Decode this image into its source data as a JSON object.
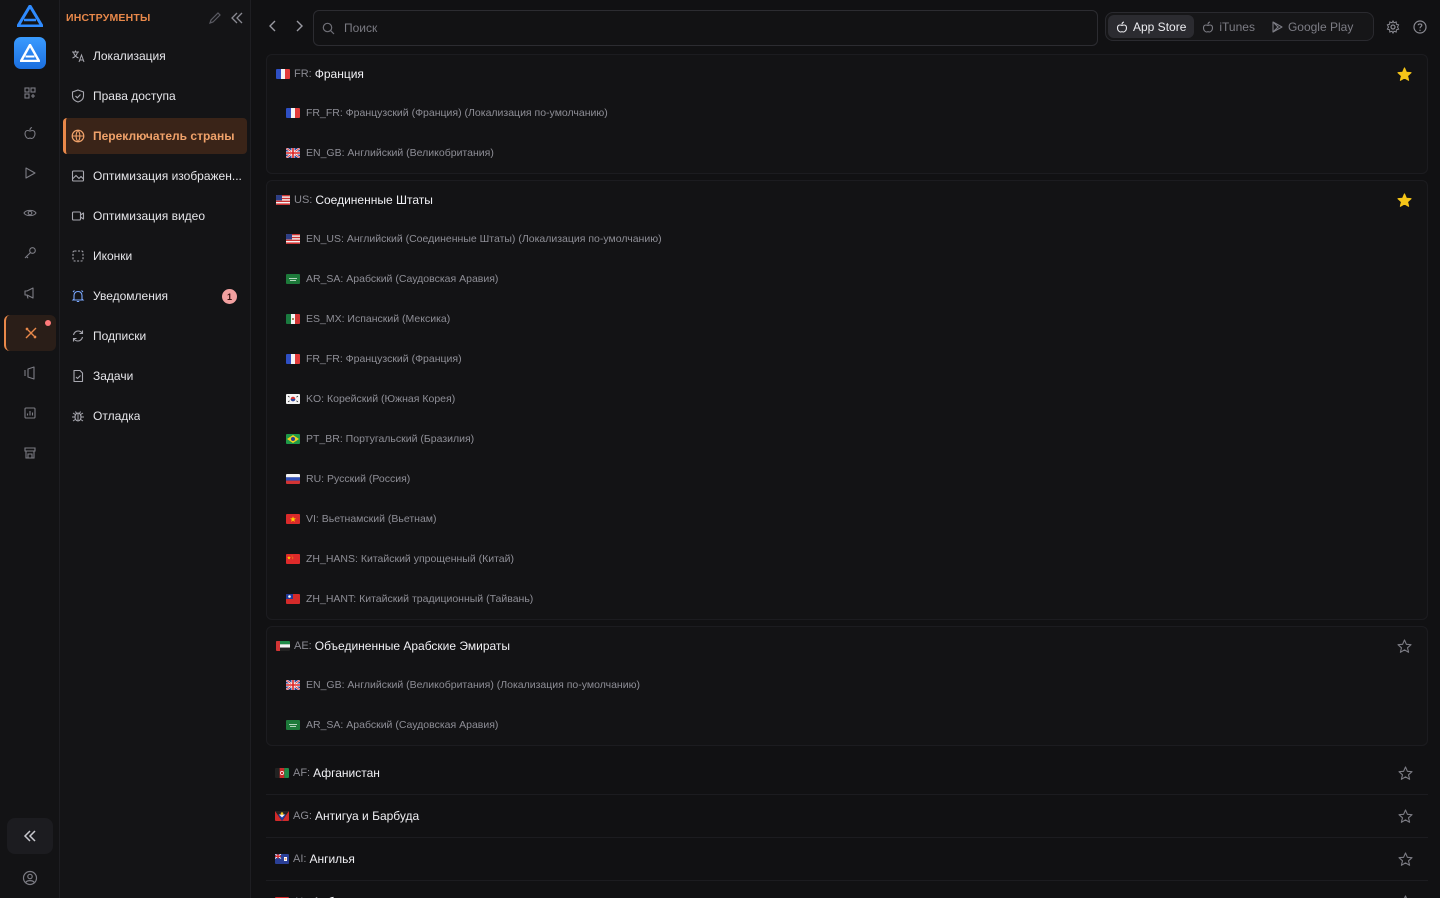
{
  "rail": {
    "items": [
      {
        "icon": "apps-icon"
      },
      {
        "icon": "apple-icon"
      },
      {
        "icon": "play-icon"
      },
      {
        "icon": "eye-icon"
      },
      {
        "icon": "key-icon"
      },
      {
        "icon": "megaphone-icon"
      },
      {
        "icon": "tools-icon",
        "active": true
      },
      {
        "icon": "feedback-icon"
      },
      {
        "icon": "report-icon"
      },
      {
        "icon": "store-icon"
      }
    ]
  },
  "tools": {
    "title": "ИНСТРУМЕНТЫ",
    "items": [
      {
        "label": "Локализация",
        "icon": "translate-icon"
      },
      {
        "label": "Права доступа",
        "icon": "shield-icon"
      },
      {
        "label": "Переключатель страны",
        "icon": "globe-icon",
        "active": true
      },
      {
        "label": "Оптимизация изображен...",
        "icon": "image-icon"
      },
      {
        "label": "Оптимизация видео",
        "icon": "video-icon"
      },
      {
        "label": "Иконки",
        "icon": "icons-icon"
      },
      {
        "label": "Уведомления",
        "icon": "bell-icon",
        "badge": "1"
      },
      {
        "label": "Подписки",
        "icon": "refresh-icon"
      },
      {
        "label": "Задачи",
        "icon": "tasks-icon"
      },
      {
        "label": "Отладка",
        "icon": "bug-icon"
      }
    ]
  },
  "search": {
    "placeholder": "Поиск"
  },
  "stores": {
    "app_store": "App Store",
    "itunes": "iTunes",
    "google_play": "Google Play"
  },
  "colors": {
    "accent": "#e8884a",
    "star_active": "#f5c518",
    "badge": "#f2a0a0"
  },
  "groups": [
    {
      "code": "FR:",
      "name": "Франция",
      "flag": "fr",
      "favorite": true,
      "locales": [
        {
          "flag": "fr",
          "text": "FR_FR: Французский (Франция) (Локализация по-умолчанию)"
        },
        {
          "flag": "gb",
          "text": "EN_GB: Английский (Великобритания)"
        }
      ]
    },
    {
      "code": "US:",
      "name": "Соединенные Штаты",
      "flag": "us",
      "favorite": true,
      "locales": [
        {
          "flag": "us",
          "text": "EN_US: Английский (Соединенные Штаты) (Локализация по-умолчанию)"
        },
        {
          "flag": "sa",
          "text": "AR_SA: Арабский (Саудовская Аравия)"
        },
        {
          "flag": "mx",
          "text": "ES_MX: Испанский (Мексика)"
        },
        {
          "flag": "fr",
          "text": "FR_FR: Французский (Франция)"
        },
        {
          "flag": "kr",
          "text": "KO: Корейский (Южная Корея)"
        },
        {
          "flag": "br",
          "text": "PT_BR: Португальский (Бразилия)"
        },
        {
          "flag": "ru",
          "text": "RU: Русский (Россия)"
        },
        {
          "flag": "vn",
          "text": "VI: Вьетнамский (Вьетнам)"
        },
        {
          "flag": "cn",
          "text": "ZH_HANS: Китайский упрощенный (Китай)"
        },
        {
          "flag": "tw",
          "text": "ZH_HANT: Китайский традиционный (Тайвань)"
        }
      ]
    },
    {
      "code": "AE:",
      "name": "Объединенные Арабские Эмираты",
      "flag": "ae",
      "favorite": false,
      "locales": [
        {
          "flag": "gb",
          "text": "EN_GB: Английский (Великобритания) (Локализация по-умолчанию)"
        },
        {
          "flag": "sa",
          "text": "AR_SA: Арабский (Саудовская Аравия)"
        }
      ]
    }
  ],
  "countries": [
    {
      "code": "AF:",
      "name": "Афганистан",
      "flag": "af"
    },
    {
      "code": "AG:",
      "name": "Антигуа и Барбуда",
      "flag": "ag"
    },
    {
      "code": "AI:",
      "name": "Ангилья",
      "flag": "ai"
    },
    {
      "code": "AL:",
      "name": "Албания",
      "flag": "al"
    }
  ]
}
